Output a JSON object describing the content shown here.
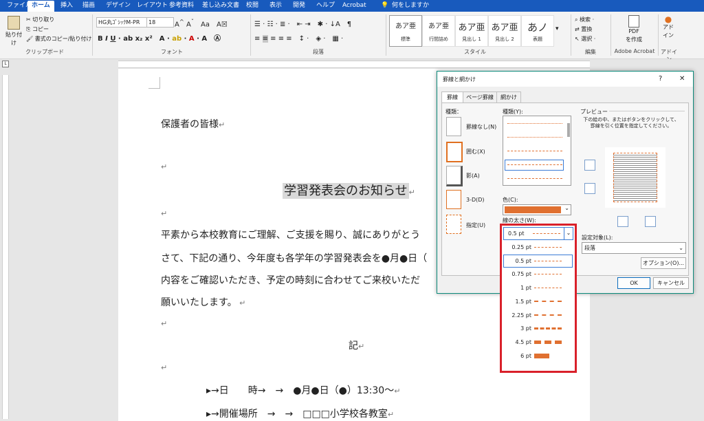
{
  "ribbon": {
    "tabs": [
      "ファイル",
      "ホーム",
      "挿入",
      "描画",
      "デザイン",
      "レイアウト",
      "参考資料",
      "差し込み文書",
      "校閲",
      "表示",
      "開発",
      "ヘルプ",
      "Acrobat",
      "何をしますか"
    ],
    "active_tab": "ホーム",
    "clipboard": {
      "paste": "貼り付け",
      "cut": "切り取り",
      "copy": "コピー",
      "format_painter": "書式のコピー/貼り付け",
      "group": "クリップボード"
    },
    "font": {
      "font_name": "HG丸ｺﾞｼｯｸM-PR",
      "font_size": "18",
      "group": "フォント"
    },
    "paragraph": {
      "group": "段落"
    },
    "styles": {
      "items": [
        {
          "preview": "あア亜",
          "label": "標準"
        },
        {
          "preview": "あア亜",
          "label": "行間詰め"
        },
        {
          "preview": "あア亜",
          "label": "見出し 1"
        },
        {
          "preview": "あア亜",
          "label": "見出し 2"
        },
        {
          "preview": "あノ",
          "label": "表題"
        }
      ],
      "group": "スタイル"
    },
    "editing": {
      "find": "検索",
      "replace": "置換",
      "select": "選択",
      "group": "編集"
    },
    "acrobat": {
      "pdf": "PDF",
      "create": "を作成",
      "group": "Adobe Acrobat"
    },
    "addin": {
      "line1": "アド",
      "line2": "イン",
      "group": "アドイン"
    }
  },
  "document": {
    "greeting": "保護者の皆様",
    "title": "学習発表会のお知らせ",
    "para1": "平素から本校教育にご理解、ご支援を賜り、誠にありがとう",
    "para2": "さて、下記の通り、今年度も各学年の学習発表会を●月●日（",
    "para3": "内容をご確認いただき、予定の時刻に合わせてご来校いただ",
    "para4": "願いいたします。",
    "ki": "記",
    "item1_label": "▸→日　　時→　→",
    "item1_value": "●月●日（●）13:30〜",
    "item2_label": "▸→開催場所　→　→",
    "item2_value": "□□□小学校各教室",
    "return_mark": "↵"
  },
  "dialog": {
    "title": "罫線と網かけ",
    "help": "?",
    "close": "✕",
    "tabs": [
      "罫線",
      "ページ罫線",
      "網かけ"
    ],
    "setting_label": "種類：",
    "settings": [
      "罫線なし(N)",
      "囲む(X)",
      "影(A)",
      "3-D(D)",
      "指定(U)"
    ],
    "style_label": "種類(Y):",
    "color_label": "色(C):",
    "color_value": "#e07030",
    "width_label": "線の太さ(W):",
    "width_value": "0.5 pt",
    "preview_label": "プレビュー",
    "preview_hint": "下の絵の中、またはボタンをクリックして、罫線を引く位置を指定してください。",
    "apply_to_label": "設定対象(L):",
    "apply_to_value": "段落",
    "options_button": "オプション(O)...",
    "ok_button": "OK",
    "cancel_button": "キャンセル"
  },
  "width_dropdown": {
    "options": [
      "0.25 pt",
      "0.5 pt",
      "0.75 pt",
      "1 pt",
      "1.5 pt",
      "2.25 pt",
      "3 pt",
      "4.5 pt",
      "6 pt"
    ],
    "selected": "0.5 pt",
    "line_color": "#e07030"
  }
}
